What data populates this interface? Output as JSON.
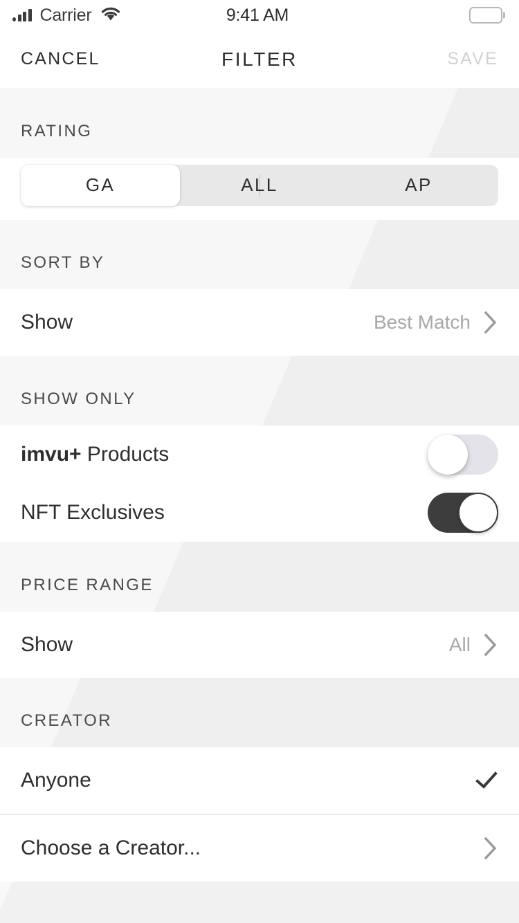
{
  "status_bar": {
    "carrier": "Carrier",
    "time": "9:41 AM",
    "signal_icon": "signal-bars-icon",
    "wifi_icon": "wifi-icon",
    "battery_icon": "battery-full-icon"
  },
  "nav": {
    "cancel_label": "CANCEL",
    "title": "FILTER",
    "save_label": "SAVE",
    "save_disabled_color": "#d2d2d2"
  },
  "sections": {
    "rating": {
      "header": "RATING",
      "options": [
        {
          "label": "GA",
          "selected": true
        },
        {
          "label": "ALL",
          "selected": false
        },
        {
          "label": "AP",
          "selected": false
        }
      ]
    },
    "sort_by": {
      "header": "SORT BY",
      "row": {
        "label": "Show",
        "value": "Best Match",
        "accessory": "chevron-right-icon"
      }
    },
    "show_only": {
      "header": "SHOW ONLY",
      "rows": [
        {
          "label_bold": "imvu+",
          "label_rest": " Products",
          "toggle": "off"
        },
        {
          "label_bold": "",
          "label_rest": "NFT Exclusives",
          "toggle": "on"
        }
      ]
    },
    "price_range": {
      "header": "PRICE RANGE",
      "row": {
        "label": "Show",
        "value": "All",
        "accessory": "chevron-right-icon"
      }
    },
    "creator": {
      "header": "CREATOR",
      "rows": [
        {
          "label": "Anyone",
          "accessory": "check-icon"
        },
        {
          "label": "Choose a Creator...",
          "accessory": "chevron-right-icon"
        }
      ]
    }
  },
  "colors": {
    "text_primary": "#2e2e2e",
    "text_muted": "#a8a8a8",
    "section_bg": "#f7f7f7",
    "segment_track": "#e8e8e8",
    "toggle_on": "#3d3d3d",
    "toggle_off": "#e3e3e9",
    "divider": "#ececec"
  }
}
